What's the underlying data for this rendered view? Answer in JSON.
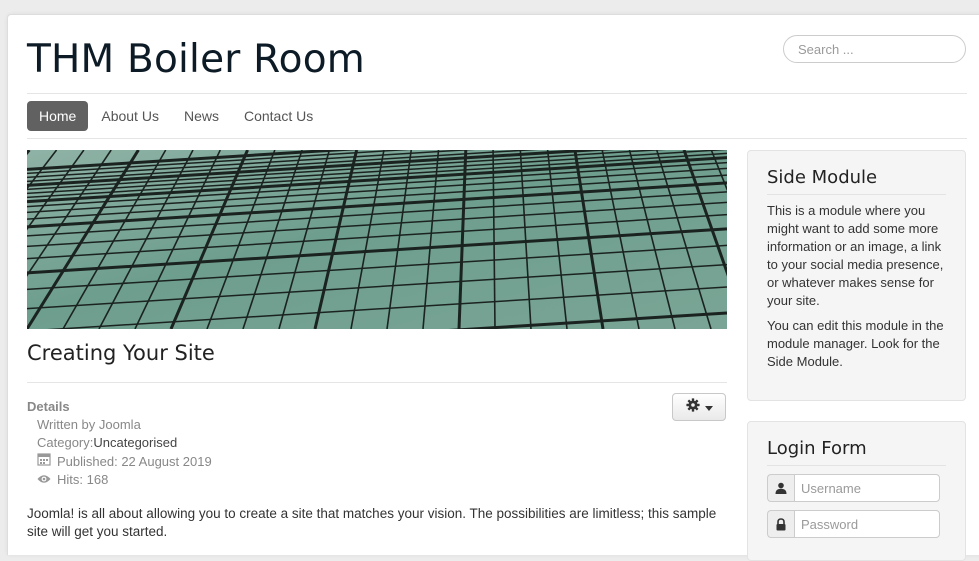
{
  "site": {
    "title": "THM Boiler Room",
    "search_placeholder": "Search ..."
  },
  "nav": {
    "items": [
      {
        "label": "Home",
        "active": true
      },
      {
        "label": "About Us",
        "active": false
      },
      {
        "label": "News",
        "active": false
      },
      {
        "label": "Contact Us",
        "active": false
      }
    ]
  },
  "article": {
    "title": "Creating Your Site",
    "details_label": "Details",
    "written_by": "Written by Joomla",
    "category_label": "Category: ",
    "category_value": "Uncategorised",
    "published": "Published: 22 August 2019",
    "hits": "Hits: 168",
    "intro": "Joomla! is all about allowing you to create a site that matches your vision. The possibilities are limitless; this sample site will get you started."
  },
  "side_module": {
    "title": "Side Module",
    "para1": "This is a module where you might want to add some more information or an image, a link to your social media presence, or whatever makes sense for your site.",
    "para2": "You can edit this module in the module manager. Look for the Side Module."
  },
  "login_form": {
    "title": "Login Form",
    "username_placeholder": "Username",
    "password_placeholder": "Password"
  },
  "icons": {
    "tools": "gear-icon",
    "dropdown": "caret-down-icon",
    "published": "calendar-icon",
    "hits": "eye-icon",
    "username": "user-icon",
    "password": "lock-icon"
  },
  "colors": {
    "nav_active_bg": "#616161",
    "title": "#0d1b26",
    "module_bg": "#f5f5f5"
  }
}
